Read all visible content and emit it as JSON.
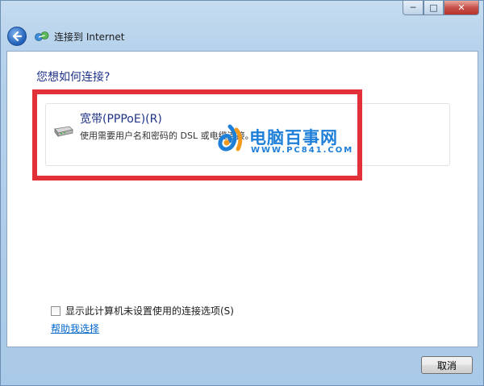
{
  "window": {
    "title": "连接到 Internet",
    "caption": {
      "minimize": "─",
      "maximize": "□",
      "close": "✕"
    }
  },
  "nav": {
    "back_icon": "back-arrow-icon",
    "network_icon": "network-connection-icon"
  },
  "main": {
    "heading": "您想如何连接?",
    "option": {
      "title": "宽带(PPPoE)(R)",
      "description": "使用需要用户名和密码的 DSL 或电缆连接。",
      "icon": "modem-icon"
    },
    "highlight_color": "#e23039",
    "checkbox_label": "显示此计算机未设置使用的连接选项(S)",
    "checkbox_checked": false,
    "help_link": "帮助我选择"
  },
  "watermark": {
    "text": "电脑百事网",
    "url": "WWW.PC841.COM"
  },
  "footer": {
    "cancel_label": "取消"
  }
}
